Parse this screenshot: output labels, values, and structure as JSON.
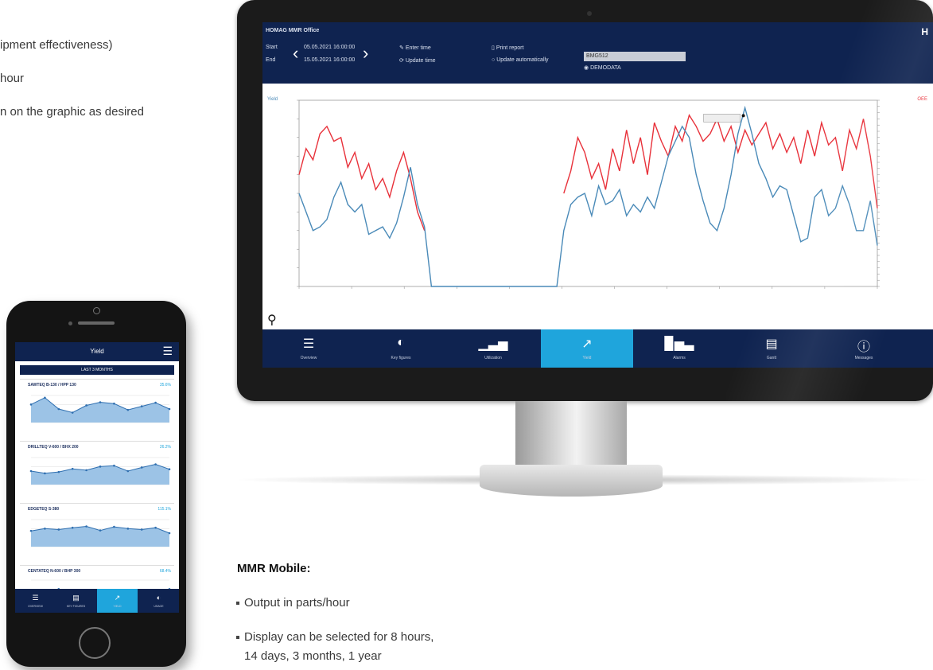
{
  "left_text": {
    "line1": "ipment effectiveness)",
    "line2": "hour",
    "line3": "n on the graphic as desired"
  },
  "desktop": {
    "app_title": "HOMAG MMR Office",
    "logo": "H",
    "start_label": "Start",
    "end_label": "End",
    "start_value": "05.05.2021 16:00:00",
    "end_value": "15.05.2021 16:00:00",
    "enter_time": "Enter time",
    "update_time": "Update time",
    "print_report": "Print report",
    "update_automatically": "Update automatically",
    "machine": "BMG512",
    "demo_data": "DEMODATA",
    "chart_left_legend": "Yield",
    "chart_right_legend": "OEE",
    "tooltip": "",
    "nav": [
      {
        "label": "Overview",
        "icon": "list-icon"
      },
      {
        "label": "Key figures",
        "icon": "pie-icon"
      },
      {
        "label": "Utilization",
        "icon": "bar-chart-icon"
      },
      {
        "label": "Yield",
        "icon": "trend-icon"
      },
      {
        "label": "Alarms",
        "icon": "alarm-bars-icon"
      },
      {
        "label": "Gantt",
        "icon": "gantt-icon"
      },
      {
        "label": "Messages",
        "icon": "info-icon"
      }
    ]
  },
  "phone": {
    "title": "Yield",
    "period_button": "LAST 3 MONTHS",
    "cards": [
      {
        "name": "SAWTEQ B-130 / HPP 130",
        "value": "35.6%",
        "trend": "down",
        "values": [
          40,
          55,
          30,
          22,
          38,
          45,
          42,
          28,
          36,
          44,
          30
        ]
      },
      {
        "name": "DRILLTEQ V-600 / BHX 200",
        "value": "26.2%",
        "trend": "up",
        "values": [
          30,
          25,
          28,
          35,
          32,
          40,
          42,
          30,
          38,
          45,
          34
        ]
      },
      {
        "name": "EDGETEQ S-380",
        "value": "115.1%",
        "trend": "down",
        "values": [
          35,
          40,
          38,
          42,
          45,
          36,
          44,
          40,
          38,
          42,
          30
        ]
      },
      {
        "name": "CENTATEQ N-600 / BHP 300",
        "value": "68.4%",
        "trend": "right",
        "values": [
          30,
          36,
          40,
          34,
          28,
          38,
          35,
          30,
          32,
          28,
          40
        ]
      }
    ],
    "nav": [
      {
        "label": "OVERVIEW",
        "icon": "list-icon"
      },
      {
        "label": "KEY FIGURES",
        "icon": "bar-chart-icon"
      },
      {
        "label": "YIELD",
        "icon": "trend-icon"
      },
      {
        "label": "USAGE",
        "icon": "pie-icon"
      }
    ]
  },
  "bottom": {
    "heading": "MMR Mobile:",
    "bullet1": "Output in parts/hour",
    "bullet2_line1": "Display can be selected for 8 hours,",
    "bullet2_line2": "14 days, 3 months, 1 year"
  },
  "chart_data": {
    "type": "line",
    "series": [
      {
        "name": "OEE",
        "color": "#e8313a",
        "values": [
          60,
          74,
          68,
          82,
          86,
          78,
          80,
          64,
          72,
          58,
          66,
          52,
          58,
          48,
          62,
          72,
          58,
          40,
          30,
          null,
          null,
          null,
          null,
          null,
          null,
          null,
          null,
          null,
          null,
          null,
          null,
          null,
          null,
          null,
          null,
          null,
          null,
          null,
          50,
          62,
          80,
          72,
          58,
          66,
          52,
          74,
          62,
          84,
          66,
          80,
          60,
          88,
          78,
          70,
          86,
          78,
          92,
          86,
          78,
          82,
          90,
          78,
          86,
          72,
          84,
          76,
          82,
          88,
          74,
          82,
          72,
          80,
          66,
          84,
          70,
          88,
          76,
          80,
          62,
          84,
          74,
          90,
          70,
          42
        ]
      },
      {
        "name": "Yield",
        "color": "#4a8ab8",
        "values": [
          50,
          40,
          30,
          32,
          36,
          48,
          56,
          44,
          40,
          44,
          28,
          30,
          32,
          26,
          34,
          48,
          64,
          44,
          32,
          0,
          0,
          0,
          0,
          0,
          0,
          0,
          0,
          0,
          0,
          0,
          0,
          0,
          0,
          0,
          0,
          0,
          0,
          0,
          30,
          44,
          48,
          50,
          38,
          54,
          44,
          46,
          52,
          38,
          44,
          40,
          48,
          42,
          56,
          70,
          78,
          86,
          80,
          60,
          46,
          34,
          30,
          42,
          60,
          82,
          96,
          82,
          66,
          58,
          48,
          54,
          52,
          38,
          24,
          26,
          48,
          52,
          38,
          42,
          54,
          44,
          30,
          30,
          46,
          22
        ]
      }
    ],
    "ylim": [
      0,
      100
    ]
  }
}
